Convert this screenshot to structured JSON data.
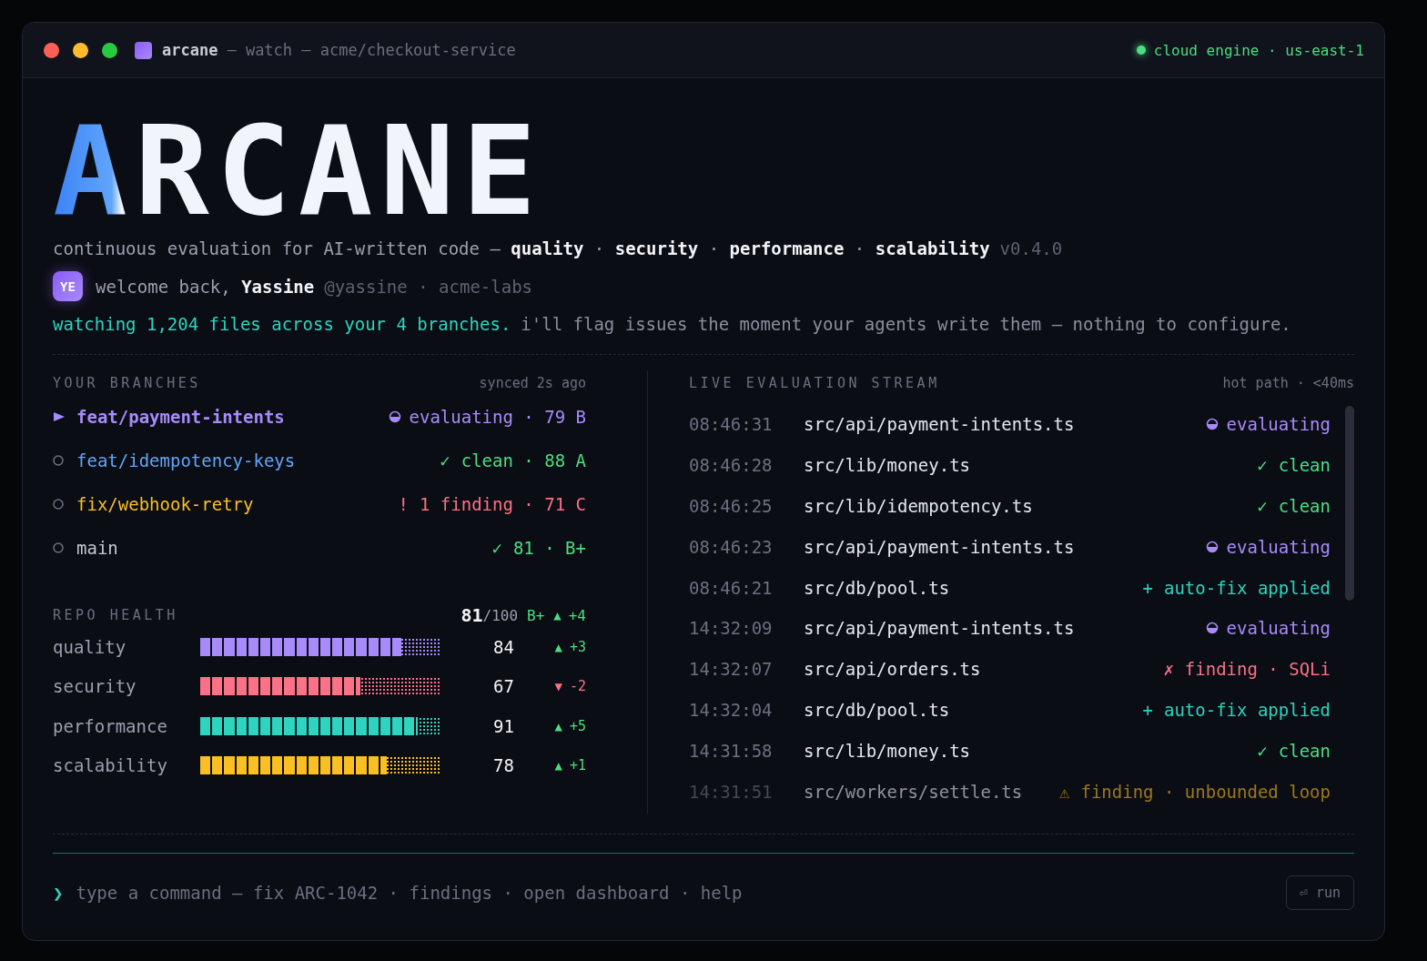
{
  "window": {
    "app": "arcane",
    "title": "— watch — acme/checkout-service",
    "engine": "cloud engine · us-east-1"
  },
  "logo": "ARCANE",
  "tagline": "continuous evaluation for AI-written code — **quality** · **security** · **performance** · **scalability**",
  "version": "v0.4.0",
  "user": {
    "initials": "YE",
    "greeting": "welcome back, **Yassine**",
    "handle": "@yassine · acme-labs"
  },
  "watching": {
    "lead": "watching 1,204 files across your 4 branches.",
    "rest": "i'll flag issues the moment your agents write them — nothing to configure."
  },
  "branches": {
    "title": "YOUR BRANCHES",
    "sync": "synced 2s ago",
    "items": [
      {
        "name": "feat/payment-intents",
        "selected": true,
        "kind": "evaluating",
        "status": "evaluating · 79 B"
      },
      {
        "name": "feat/idempotency-keys",
        "selected": false,
        "kind": "clean",
        "icon": "✓",
        "status": "clean · 88 A"
      },
      {
        "name": "fix/webhook-retry",
        "selected": false,
        "kind": "finding",
        "icon": "!",
        "status": "1 finding · 71 C"
      },
      {
        "name": "main",
        "selected": false,
        "kind": "default",
        "icon": "✓",
        "status": "81 · B+"
      }
    ]
  },
  "health": {
    "title": "REPO HEALTH",
    "score": "81",
    "max": "/100",
    "grade": "B+",
    "kind": "gain",
    "arrow": "▲",
    "delta": "+4",
    "metrics": [
      {
        "name": "quality",
        "color": "#a78bfa",
        "level": 0.84,
        "value": "84",
        "kind": "gain",
        "arrow": "▲",
        "delta": "+3"
      },
      {
        "name": "security",
        "color": "#fb7185",
        "level": 0.67,
        "value": "67",
        "kind": "loss",
        "arrow": "▼",
        "delta": "-2"
      },
      {
        "name": "performance",
        "color": "#2dd4bf",
        "level": 0.91,
        "value": "91",
        "kind": "gain",
        "arrow": "▲",
        "delta": "+5"
      },
      {
        "name": "scalability",
        "color": "#fbbf24",
        "level": 0.78,
        "value": "78",
        "kind": "gain",
        "arrow": "▲",
        "delta": "+1"
      }
    ]
  },
  "stream": {
    "title": "LIVE EVALUATION STREAM",
    "meta": "hot path · <40ms",
    "rows": [
      {
        "time": "08:46:31",
        "file": "src/api/payment-intents.ts",
        "kind": "evaluating",
        "status": "evaluating"
      },
      {
        "time": "08:46:28",
        "file": "src/lib/money.ts",
        "kind": "clean",
        "icon": "✓",
        "status": "clean"
      },
      {
        "time": "08:46:25",
        "file": "src/lib/idempotency.ts",
        "kind": "clean",
        "icon": "✓",
        "status": "clean"
      },
      {
        "time": "08:46:23",
        "file": "src/api/payment-intents.ts",
        "kind": "evaluating",
        "status": "evaluating"
      },
      {
        "time": "08:46:21",
        "file": "src/db/pool.ts",
        "kind": "autofix",
        "icon": "+",
        "status": "auto-fix applied"
      },
      {
        "time": "14:32:09",
        "file": "src/api/payment-intents.ts",
        "kind": "evaluating",
        "status": "evaluating"
      },
      {
        "time": "14:32:07",
        "file": "src/api/orders.ts",
        "kind": "finding",
        "icon": "✗",
        "status": "finding · SQLi"
      },
      {
        "time": "14:32:04",
        "file": "src/db/pool.ts",
        "kind": "autofix",
        "icon": "+",
        "status": "auto-fix applied"
      },
      {
        "time": "14:31:58",
        "file": "src/lib/money.ts",
        "kind": "clean",
        "icon": "✓",
        "status": "clean"
      },
      {
        "time": "14:31:51",
        "file": "src/workers/settle.ts",
        "kind": "warning",
        "icon": "⚠",
        "status": "finding · unbounded loop"
      }
    ]
  },
  "command": {
    "prompt": "❯",
    "placeholder": "type a command — fix ARC-1042 · findings · open dashboard · help",
    "button": "⏎ run"
  }
}
